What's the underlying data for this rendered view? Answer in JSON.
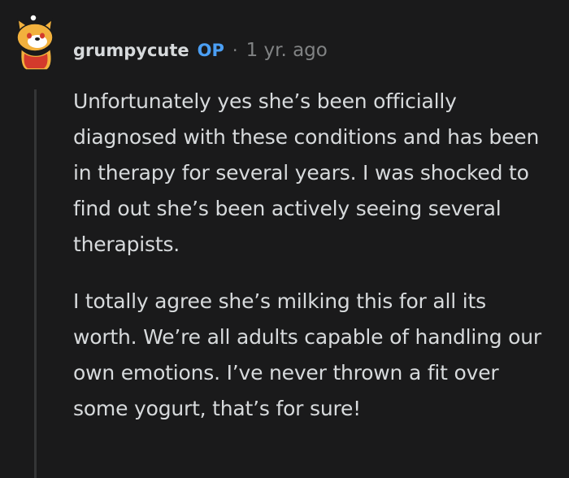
{
  "comment": {
    "author": "grumpycute",
    "op_badge": "OP",
    "separator": "·",
    "timestamp": "1 yr. ago",
    "avatar_icon": "snoo-avatar-icon",
    "paragraphs": [
      "Unfortunately yes she’s been officially diagnosed with these conditions and has been in therapy for several years. I was shocked to find out she’s been actively seeing several therapists.",
      "I totally agree she’s milking this for all its worth. We’re all adults capable of handling our own emotions. I’ve never thrown a fit over some yogurt, that’s for sure!"
    ]
  },
  "colors": {
    "background": "#1a1a1b",
    "text": "#d7dadc",
    "muted": "#818384",
    "op_badge": "#4b9ff4",
    "thread_line": "#343536"
  }
}
